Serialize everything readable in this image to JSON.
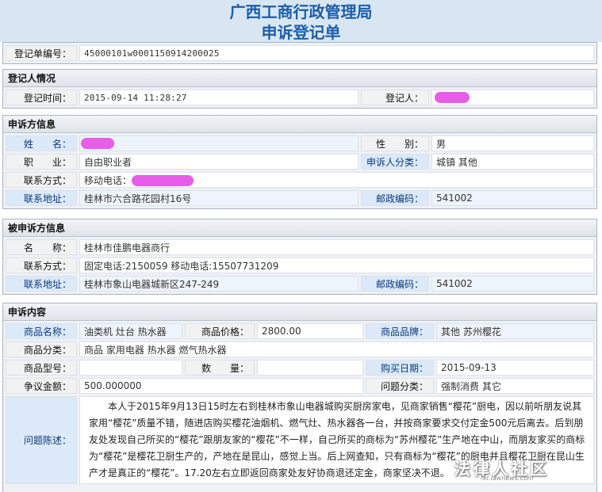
{
  "header": {
    "title_line1": "广西工商行政管理局",
    "title_line2": "申诉登记单"
  },
  "registration": {
    "number_label": "登记单编号：",
    "number": "45000101w0001150914200025"
  },
  "registrant": {
    "section_title": "登记人情况",
    "time_label": "登记时间：",
    "time": "2015-09-14 11:28:27",
    "person_label": "登记人："
  },
  "complainant": {
    "section_title": "申诉方信息",
    "name_label": "姓　　名：",
    "gender_label": "性　　别：",
    "gender": "男",
    "occupation_label": "职　　业：",
    "occupation": "自由职业者",
    "category_label": "申诉人分类：",
    "category": "城镇 其他",
    "contact_label": "联系方式：",
    "contact_prefix": "移动电话：",
    "address_label": "联系地址：",
    "address": "桂林市六合路花园村16号",
    "postcode_label": "邮政编码：",
    "postcode": "541002"
  },
  "respondent": {
    "section_title": "被申诉方信息",
    "name_label": "名　　称：",
    "name": "桂林市佳鹏电器商行",
    "contact_label": "联系方式：",
    "contact": "固定电话:2150059 移动电话:15507731209",
    "address_label": "联系地址：",
    "address": "桂林市象山电器城新区247-249",
    "postcode_label": "邮政编码：",
    "postcode": "541002"
  },
  "complaint": {
    "section_title": "申诉内容",
    "product_name_label": "商品名称：",
    "product_name": "油类机 灶台 热水器",
    "price_label": "商品价格：",
    "price": "2800.00",
    "brand_label": "商品品牌：",
    "brand": "其他 苏州樱花",
    "product_category_label": "商品分类：",
    "product_category": "商品 家用电器 热水器 燃气热水器",
    "model_label": "商品型号：",
    "model": "",
    "quantity_label": "数　　量：",
    "quantity": "",
    "purchase_date_label": "购买日期：",
    "purchase_date": "2015-09-13",
    "amount_label": "争议金额：",
    "amount": "500.000000",
    "issue_category_label": "问题分类：",
    "issue_category": "强制消费 其它",
    "description_label": "问题陈述：",
    "description": "本人于2015年9月13日15时左右到桂林市象山电器城购买厨房家电，见商家销售“樱花”厨电，因以前听朋友说其家用“樱花”质量不错，随进店购买樱花油烟机、燃气灶、热水器各一台，并按商家要求交付定金500元后离去。后到朋友处发现自己所买的“樱花”跟朋友家的“樱花”不一样，自己所买的商标为“苏州樱花”生产地在中山，而朋友家买的商标为“樱花”是樱花卫厨生产的，产地在是昆山，感觉上当。后上网查知，只有商标为“樱花”的厨电并且樱花卫厨在昆山生产才是真正的“樱花”。17.20左右立即返回商家处友好协商退还定金，商家坚决不退。"
  },
  "watermark": {
    "main": "法律人社区",
    "sub": "fxr.lawnews.com"
  },
  "colors": {
    "title": "#1c5ea8",
    "redaction": "#e85de8",
    "label_blue": "#0b3a7a"
  }
}
